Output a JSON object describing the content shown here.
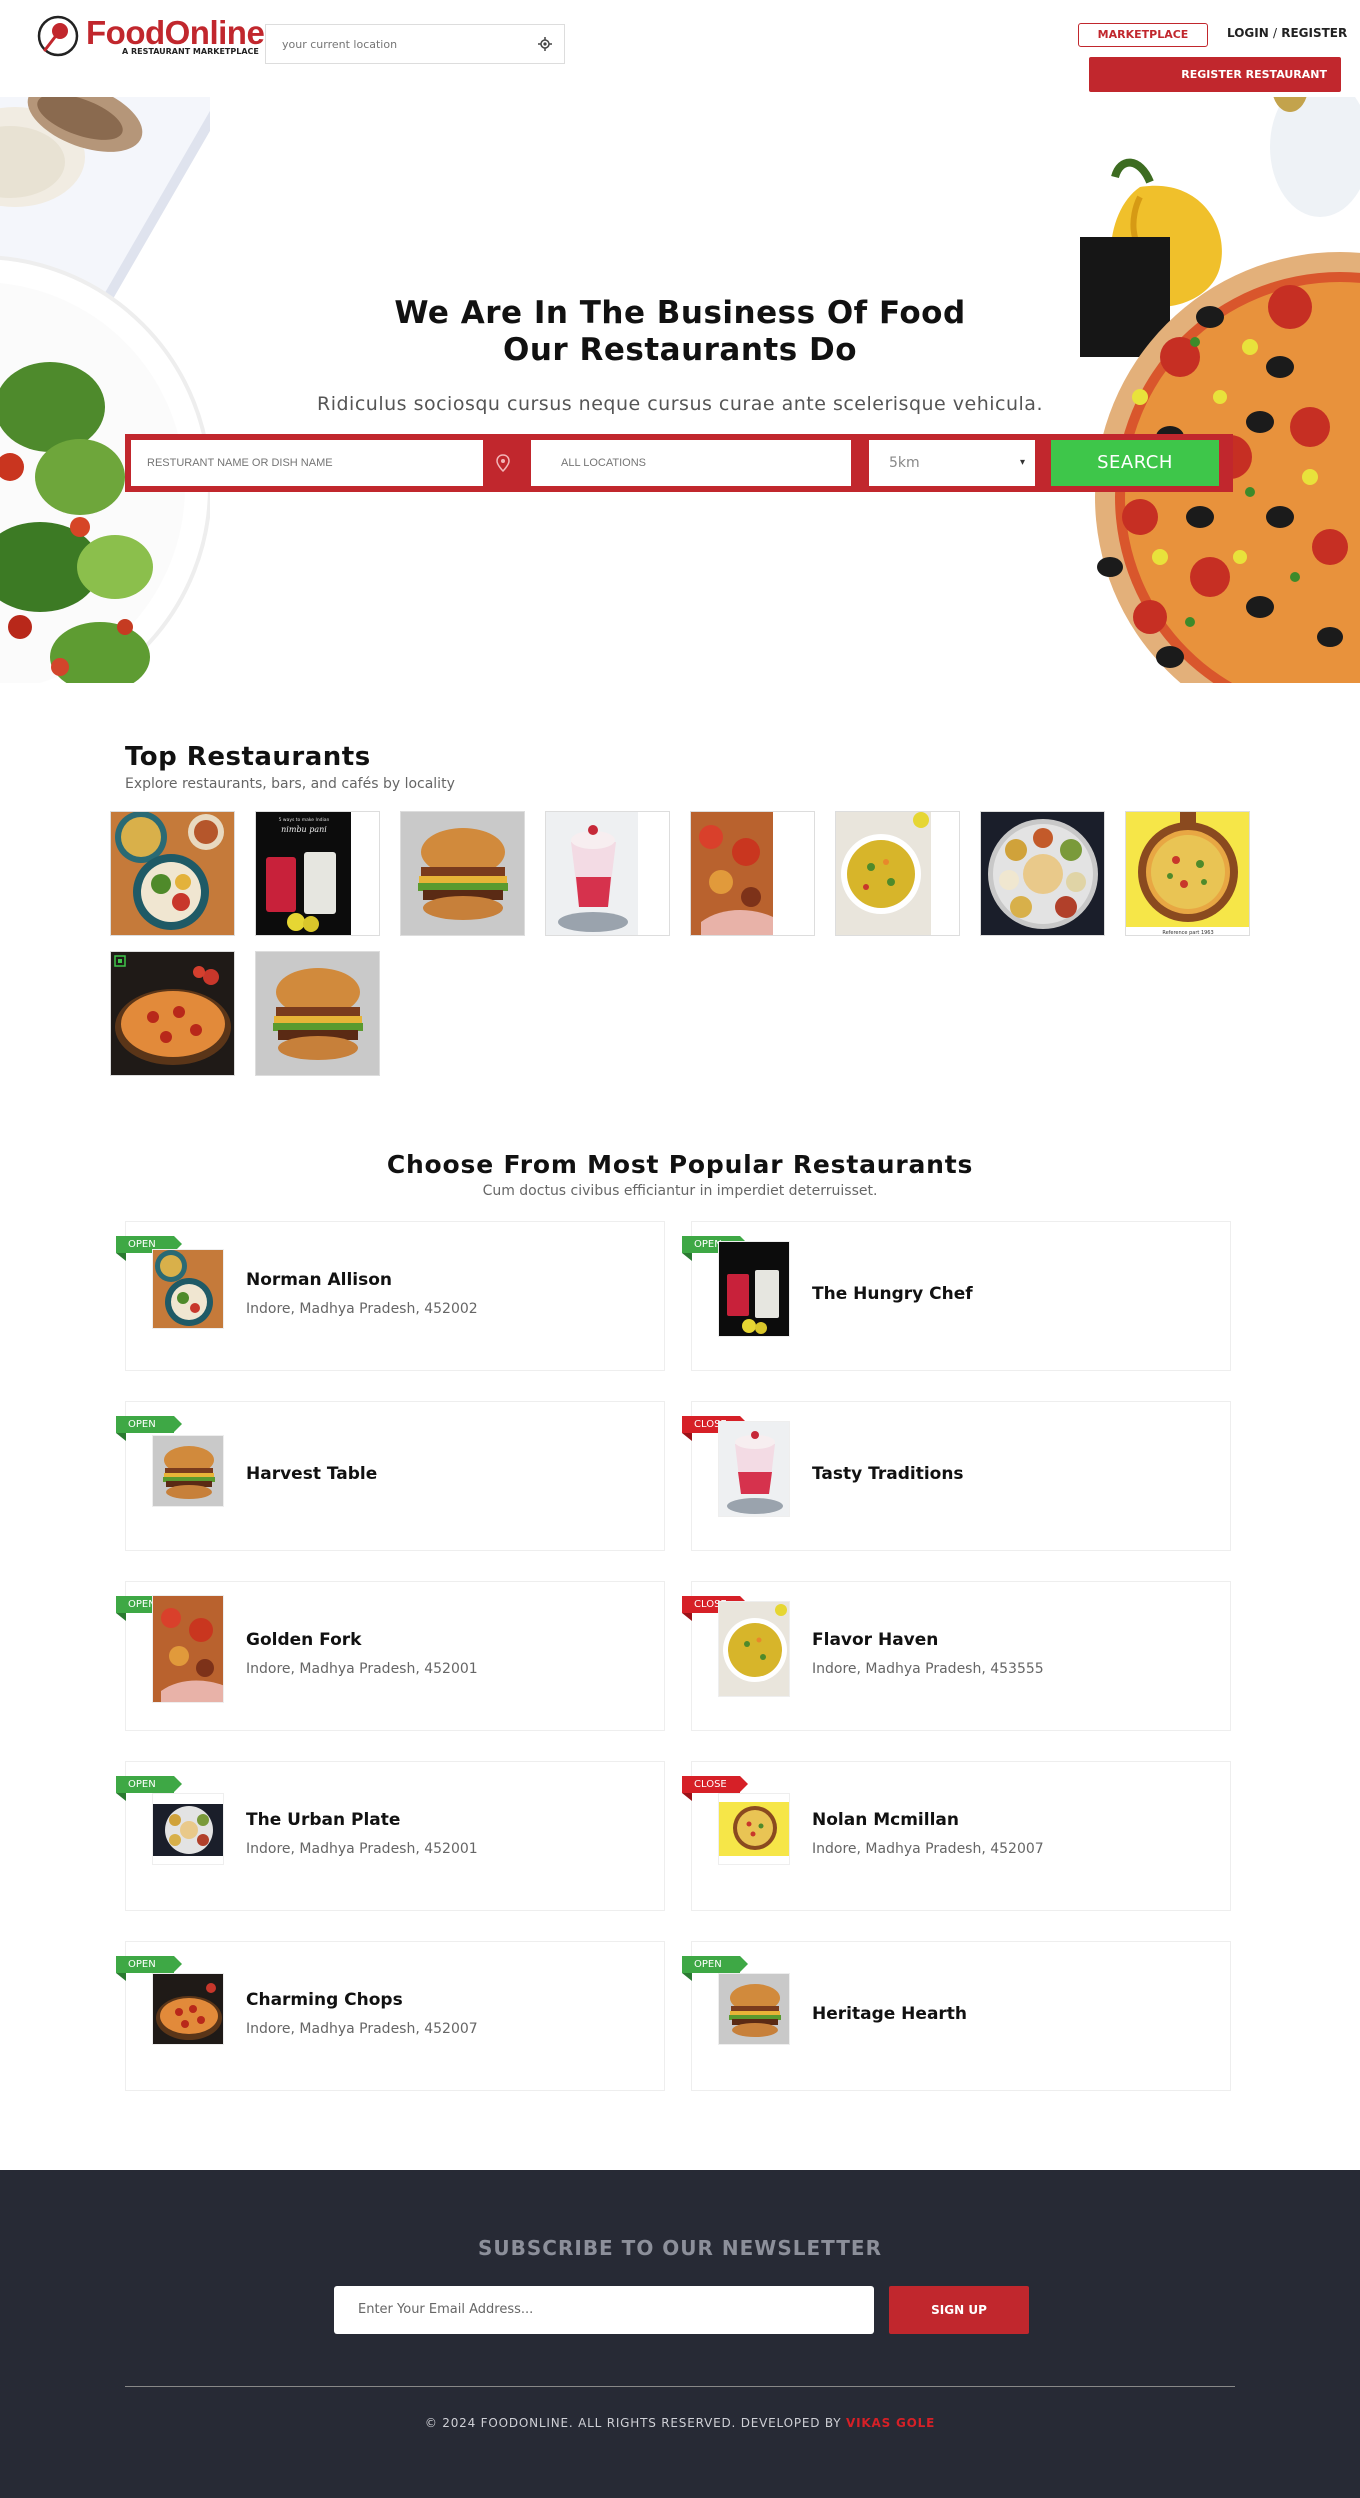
{
  "header": {
    "logo_text": "FoodOnline",
    "logo_tagline": "A RESTAURANT MARKETPLACE",
    "location_placeholder": "your current location",
    "marketplace_label": "MARKETPLACE",
    "login_label": "LOGIN",
    "separator": "/",
    "register_label": "REGISTER",
    "register_restaurant_label": "REGISTER RESTAURANT"
  },
  "hero": {
    "title_line1": "We Are In The Business Of Food",
    "title_line2": "Our Restaurants Do",
    "subtitle": "Ridiculus sociosqu cursus neque cursus curae ante scelerisque vehicula.",
    "search_placeholder": "RESTURANT NAME OR DISH NAME",
    "location_placeholder": "ALL LOCATIONS",
    "radius_selected": "5km",
    "search_button": "SEARCH"
  },
  "top_restaurants": {
    "title": "Top Restaurants",
    "subtitle": "Explore restaurants, bars, and cafés by locality",
    "thumb_caption_nimbu": "nimbu pani",
    "thumb_caption_nimbu_small": "5 ways to make Indian",
    "thumb_caption_pizza": "Reference part 1963"
  },
  "popular": {
    "title": "Choose From Most Popular Restaurants",
    "subtitle": "Cum doctus civibus efficiantur in imperdiet deterruisset.",
    "restaurants": [
      {
        "status": "OPEN",
        "name": "Norman Allison",
        "address": "Indore, Madhya Pradesh, 452002"
      },
      {
        "status": "OPEN",
        "name": "The Hungry Chef",
        "address": ""
      },
      {
        "status": "OPEN",
        "name": "Harvest Table",
        "address": ""
      },
      {
        "status": "CLOSE",
        "name": "Tasty Traditions",
        "address": ""
      },
      {
        "status": "OPEN",
        "name": "Golden Fork",
        "address": "Indore, Madhya Pradesh, 452001"
      },
      {
        "status": "CLOSE",
        "name": "Flavor Haven",
        "address": "Indore, Madhya Pradesh, 453555"
      },
      {
        "status": "OPEN",
        "name": "The Urban Plate",
        "address": "Indore, Madhya Pradesh, 452001"
      },
      {
        "status": "CLOSE",
        "name": "Nolan Mcmillan",
        "address": "Indore, Madhya Pradesh, 452007"
      },
      {
        "status": "OPEN",
        "name": "Charming Chops",
        "address": "Indore, Madhya Pradesh, 452007"
      },
      {
        "status": "OPEN",
        "name": "Heritage Hearth",
        "address": ""
      }
    ]
  },
  "footer": {
    "newsletter_title": "SUBSCRIBE TO OUR NEWSLETTER",
    "email_placeholder": "Enter Your Email Address...",
    "signup_button": "SIGN UP",
    "copyright_text": "© 2024 FOODONLINE. ALL RIGHTS RESERVED. DEVELOPED BY",
    "developer_name": "VIKAS GOLE"
  },
  "colors": {
    "brand_red": "#c1272d",
    "search_green": "#3ec64a",
    "open_green": "#3ea845",
    "close_red": "#d62027",
    "footer_bg": "#272a35"
  }
}
